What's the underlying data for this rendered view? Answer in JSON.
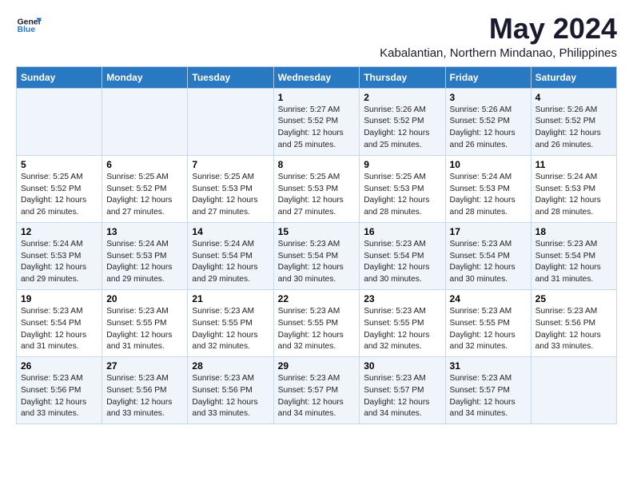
{
  "header": {
    "logo_line1": "General",
    "logo_line2": "Blue",
    "main_title": "May 2024",
    "subtitle": "Kabalantian, Northern Mindanao, Philippines"
  },
  "weekdays": [
    "Sunday",
    "Monday",
    "Tuesday",
    "Wednesday",
    "Thursday",
    "Friday",
    "Saturday"
  ],
  "weeks": [
    [
      {
        "day": "",
        "info": ""
      },
      {
        "day": "",
        "info": ""
      },
      {
        "day": "",
        "info": ""
      },
      {
        "day": "1",
        "info": "Sunrise: 5:27 AM\nSunset: 5:52 PM\nDaylight: 12 hours\nand 25 minutes."
      },
      {
        "day": "2",
        "info": "Sunrise: 5:26 AM\nSunset: 5:52 PM\nDaylight: 12 hours\nand 25 minutes."
      },
      {
        "day": "3",
        "info": "Sunrise: 5:26 AM\nSunset: 5:52 PM\nDaylight: 12 hours\nand 26 minutes."
      },
      {
        "day": "4",
        "info": "Sunrise: 5:26 AM\nSunset: 5:52 PM\nDaylight: 12 hours\nand 26 minutes."
      }
    ],
    [
      {
        "day": "5",
        "info": "Sunrise: 5:25 AM\nSunset: 5:52 PM\nDaylight: 12 hours\nand 26 minutes."
      },
      {
        "day": "6",
        "info": "Sunrise: 5:25 AM\nSunset: 5:52 PM\nDaylight: 12 hours\nand 27 minutes."
      },
      {
        "day": "7",
        "info": "Sunrise: 5:25 AM\nSunset: 5:53 PM\nDaylight: 12 hours\nand 27 minutes."
      },
      {
        "day": "8",
        "info": "Sunrise: 5:25 AM\nSunset: 5:53 PM\nDaylight: 12 hours\nand 27 minutes."
      },
      {
        "day": "9",
        "info": "Sunrise: 5:25 AM\nSunset: 5:53 PM\nDaylight: 12 hours\nand 28 minutes."
      },
      {
        "day": "10",
        "info": "Sunrise: 5:24 AM\nSunset: 5:53 PM\nDaylight: 12 hours\nand 28 minutes."
      },
      {
        "day": "11",
        "info": "Sunrise: 5:24 AM\nSunset: 5:53 PM\nDaylight: 12 hours\nand 28 minutes."
      }
    ],
    [
      {
        "day": "12",
        "info": "Sunrise: 5:24 AM\nSunset: 5:53 PM\nDaylight: 12 hours\nand 29 minutes."
      },
      {
        "day": "13",
        "info": "Sunrise: 5:24 AM\nSunset: 5:53 PM\nDaylight: 12 hours\nand 29 minutes."
      },
      {
        "day": "14",
        "info": "Sunrise: 5:24 AM\nSunset: 5:54 PM\nDaylight: 12 hours\nand 29 minutes."
      },
      {
        "day": "15",
        "info": "Sunrise: 5:23 AM\nSunset: 5:54 PM\nDaylight: 12 hours\nand 30 minutes."
      },
      {
        "day": "16",
        "info": "Sunrise: 5:23 AM\nSunset: 5:54 PM\nDaylight: 12 hours\nand 30 minutes."
      },
      {
        "day": "17",
        "info": "Sunrise: 5:23 AM\nSunset: 5:54 PM\nDaylight: 12 hours\nand 30 minutes."
      },
      {
        "day": "18",
        "info": "Sunrise: 5:23 AM\nSunset: 5:54 PM\nDaylight: 12 hours\nand 31 minutes."
      }
    ],
    [
      {
        "day": "19",
        "info": "Sunrise: 5:23 AM\nSunset: 5:54 PM\nDaylight: 12 hours\nand 31 minutes."
      },
      {
        "day": "20",
        "info": "Sunrise: 5:23 AM\nSunset: 5:55 PM\nDaylight: 12 hours\nand 31 minutes."
      },
      {
        "day": "21",
        "info": "Sunrise: 5:23 AM\nSunset: 5:55 PM\nDaylight: 12 hours\nand 32 minutes."
      },
      {
        "day": "22",
        "info": "Sunrise: 5:23 AM\nSunset: 5:55 PM\nDaylight: 12 hours\nand 32 minutes."
      },
      {
        "day": "23",
        "info": "Sunrise: 5:23 AM\nSunset: 5:55 PM\nDaylight: 12 hours\nand 32 minutes."
      },
      {
        "day": "24",
        "info": "Sunrise: 5:23 AM\nSunset: 5:55 PM\nDaylight: 12 hours\nand 32 minutes."
      },
      {
        "day": "25",
        "info": "Sunrise: 5:23 AM\nSunset: 5:56 PM\nDaylight: 12 hours\nand 33 minutes."
      }
    ],
    [
      {
        "day": "26",
        "info": "Sunrise: 5:23 AM\nSunset: 5:56 PM\nDaylight: 12 hours\nand 33 minutes."
      },
      {
        "day": "27",
        "info": "Sunrise: 5:23 AM\nSunset: 5:56 PM\nDaylight: 12 hours\nand 33 minutes."
      },
      {
        "day": "28",
        "info": "Sunrise: 5:23 AM\nSunset: 5:56 PM\nDaylight: 12 hours\nand 33 minutes."
      },
      {
        "day": "29",
        "info": "Sunrise: 5:23 AM\nSunset: 5:57 PM\nDaylight: 12 hours\nand 34 minutes."
      },
      {
        "day": "30",
        "info": "Sunrise: 5:23 AM\nSunset: 5:57 PM\nDaylight: 12 hours\nand 34 minutes."
      },
      {
        "day": "31",
        "info": "Sunrise: 5:23 AM\nSunset: 5:57 PM\nDaylight: 12 hours\nand 34 minutes."
      },
      {
        "day": "",
        "info": ""
      }
    ]
  ]
}
